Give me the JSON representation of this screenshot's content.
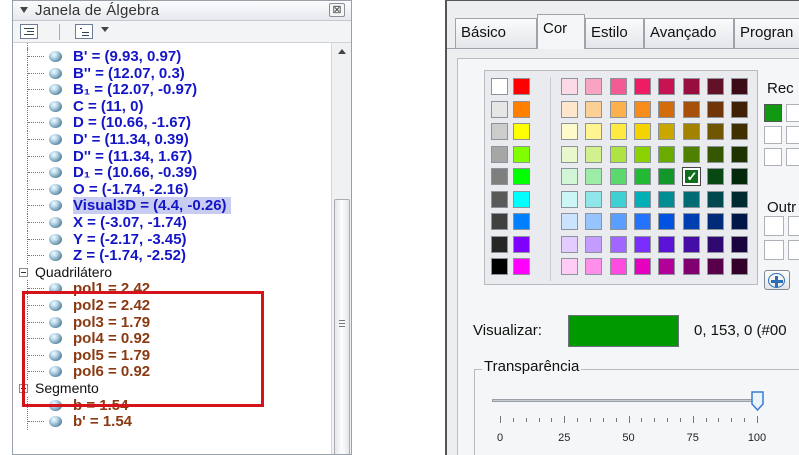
{
  "algebra_view": {
    "title": "Janela de Álgebra",
    "close_glyph": "⊠",
    "rows": [
      {
        "text": "B' = (9.93, 0.97)",
        "color": "blue",
        "kind": "item"
      },
      {
        "text": "B'' = (12.07, 0.3)",
        "color": "blue",
        "kind": "item"
      },
      {
        "text": "B₁ = (12.07, -0.97)",
        "color": "blue",
        "kind": "item"
      },
      {
        "text": "C = (11, 0)",
        "color": "blue",
        "kind": "item"
      },
      {
        "text": "D = (10.66, -1.67)",
        "color": "blue",
        "kind": "item"
      },
      {
        "text": "D' = (11.34, 0.39)",
        "color": "blue",
        "kind": "item"
      },
      {
        "text": "D'' = (11.34, 1.67)",
        "color": "blue",
        "kind": "item"
      },
      {
        "text": "D₁ = (10.66, -0.39)",
        "color": "blue",
        "kind": "item"
      },
      {
        "text": "O = (-1.74, -2.16)",
        "color": "blue",
        "kind": "item"
      },
      {
        "text": "Visual3D = (4.4, -0.26)",
        "color": "blue",
        "kind": "item",
        "selected": true
      },
      {
        "text": "X = (-3.07, -1.74)",
        "color": "blue",
        "kind": "item"
      },
      {
        "text": "Y = (-2.17, -3.45)",
        "color": "blue",
        "kind": "item"
      },
      {
        "text": "Z = (-1.74, -2.52)",
        "color": "blue",
        "kind": "item"
      },
      {
        "text": "Quadrilátero",
        "kind": "group"
      },
      {
        "text": "pol1 = 2.42",
        "color": "brown",
        "kind": "item"
      },
      {
        "text": "pol2 = 2.42",
        "color": "brown",
        "kind": "item"
      },
      {
        "text": "pol3 = 1.79",
        "color": "brown",
        "kind": "item"
      },
      {
        "text": "pol4 = 0.92",
        "color": "brown",
        "kind": "item"
      },
      {
        "text": "pol5 = 1.79",
        "color": "brown",
        "kind": "item"
      },
      {
        "text": "pol6 = 0.92",
        "color": "brown",
        "kind": "item"
      },
      {
        "text": "Segmento",
        "kind": "group"
      },
      {
        "text": "b = 1.54",
        "color": "brown",
        "kind": "item"
      },
      {
        "text": "b' = 1.54",
        "color": "brown",
        "kind": "item"
      }
    ]
  },
  "properties": {
    "tabs": [
      "Básico",
      "Cor",
      "Estilo",
      "Avançado",
      "Progran"
    ],
    "active_tab": "Cor",
    "recent_label": "Rec",
    "other_label": "Outr",
    "recent_colors": [
      "#119911"
    ],
    "preview_label": "Visualizar:",
    "preview_color": "#009900",
    "preview_value": "0, 153, 0 (#00",
    "transparency_label": "Transparência",
    "transparency_value": 100,
    "tick_labels": [
      "0",
      "25",
      "50",
      "75",
      "100"
    ],
    "palette_left": [
      [
        "#ffffff",
        "#ff0000"
      ],
      [
        "#e6e6e6",
        "#ff8000"
      ],
      [
        "#cccccc",
        "#ffff00"
      ],
      [
        "#a6a6a6",
        "#80ff00"
      ],
      [
        "#7f7f7f",
        "#00ff00"
      ],
      [
        "#595959",
        "#00ffff"
      ],
      [
        "#404040",
        "#0080ff"
      ],
      [
        "#262626",
        "#8000ff"
      ],
      [
        "#000000",
        "#ff00ff"
      ]
    ],
    "palette_main": [
      [
        "#fcd9e6",
        "#f9a3c2",
        "#f35b93",
        "#ef1c64",
        "#c81352",
        "#970e3f",
        "#621227",
        "#3b0b16"
      ],
      [
        "#fde6cc",
        "#fccf94",
        "#fbb14c",
        "#f78c1d",
        "#d36c0b",
        "#a6500a",
        "#703609",
        "#3f2205"
      ],
      [
        "#fffacc",
        "#fff48f",
        "#ffe943",
        "#f4d300",
        "#c9a700",
        "#a38200",
        "#705600",
        "#403000"
      ],
      [
        "#e9f8cc",
        "#d2f08e",
        "#aee343",
        "#8bd200",
        "#6aab00",
        "#4f8000",
        "#355700",
        "#1e3300"
      ],
      [
        "#d1f5d5",
        "#9deba6",
        "#5cd96c",
        "#22b935",
        "#13962a",
        "#0e6e1c",
        "#084813",
        "#03290a"
      ],
      [
        "#ccf5f6",
        "#8ee6e8",
        "#3fd0d4",
        "#00b0b6",
        "#008d93",
        "#006b72",
        "#004a4f",
        "#002a2e"
      ],
      [
        "#cce3ff",
        "#95c4ff",
        "#5a9eff",
        "#2473ff",
        "#0052e0",
        "#003fb0",
        "#002b78",
        "#001747"
      ],
      [
        "#e3ccff",
        "#c49cff",
        "#a066ff",
        "#7b2cff",
        "#5d12d8",
        "#450da5",
        "#2f0870",
        "#1a0440"
      ],
      [
        "#ffccf6",
        "#ff8fea",
        "#ff4ce0",
        "#e600c0",
        "#b30099",
        "#800070",
        "#570049",
        "#330029"
      ]
    ],
    "selected_swatch": {
      "row": 4,
      "col": 5
    }
  }
}
